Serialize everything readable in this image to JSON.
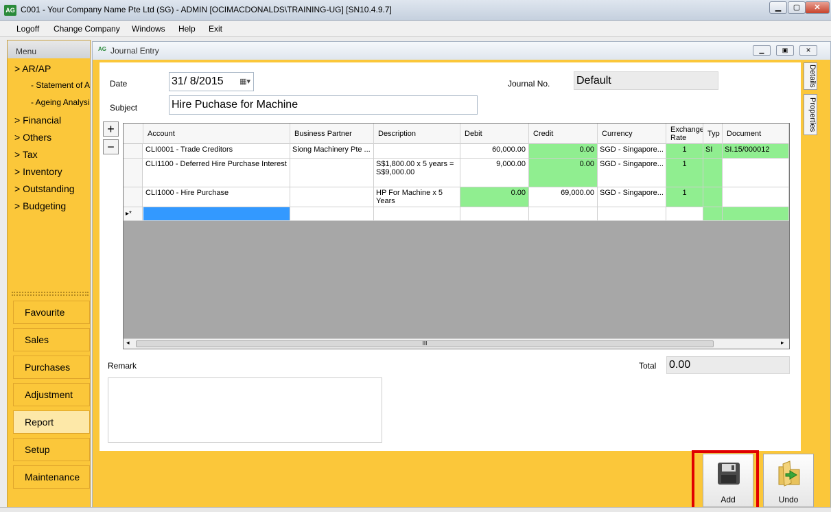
{
  "window": {
    "title": "C001 - Your Company Name Pte Ltd (SG) - ADMIN [OCIMACDONALDS\\TRAINING-UG] [SN10.4.9.7]",
    "logo": "AG",
    "minimize_icon": "minimize-icon",
    "maximize_icon": "maximize-icon",
    "close_icon": "close-icon"
  },
  "menubar": [
    "Logoff",
    "Change Company",
    "Windows",
    "Help",
    "Exit"
  ],
  "sidebar": {
    "header": "Menu",
    "links": [
      {
        "label": "> AR/AP"
      },
      {
        "label": "- Statement of A",
        "sub": true
      },
      {
        "label": "- Ageing Analysis",
        "sub": true
      },
      {
        "label": "> Financial"
      },
      {
        "label": "> Others"
      },
      {
        "label": "> Tax"
      },
      {
        "label": "> Inventory"
      },
      {
        "label": "> Outstanding"
      },
      {
        "label": "> Budgeting"
      }
    ],
    "buttons": [
      "Favourite",
      "Sales",
      "Purchases",
      "Adjustment",
      "Report",
      "Setup",
      "Maintenance"
    ],
    "active_button": "Report"
  },
  "journal": {
    "title": "Journal Entry",
    "logo": "AG",
    "date_label": "Date",
    "date_value": "31/  8/2015",
    "subject_label": "Subject",
    "subject_value": "Hire Puchase for Machine",
    "journal_no_label": "Journal No.",
    "journal_no_value": "Default",
    "add_row_symbol": "+",
    "remove_row_symbol": "−",
    "columns": [
      "Account",
      "Business Partner",
      "Description",
      "Debit",
      "Credit",
      "Currency",
      "Exchange Rate",
      "Typ",
      "Document"
    ],
    "rows": [
      {
        "account": "CLI0001 - Trade Creditors",
        "partner": "Siong Machinery Pte ...",
        "description": "",
        "debit": "60,000.00",
        "credit": "0.00",
        "currency": "SGD - Singapore...",
        "rate": "1",
        "type": "SI",
        "document": "SI.15/000012"
      },
      {
        "account": "CLI1100 - Deferred Hire Purchase Interest",
        "partner": "",
        "description": "S$1,800.00 x 5 years = S$9,000.00",
        "debit": "9,000.00",
        "credit": "0.00",
        "currency": "SGD - Singapore...",
        "rate": "1",
        "type": "",
        "document": ""
      },
      {
        "account": "CLI1000 - Hire Purchase",
        "partner": "",
        "description": "HP For Machine x 5 Years",
        "debit": "0.00",
        "credit": "69,000.00",
        "currency": "SGD - Singapore...",
        "rate": "1",
        "type": "",
        "document": ""
      }
    ],
    "new_row_marker": "▸*",
    "scroll_grip": "III",
    "remark_label": "Remark",
    "total_label": "Total",
    "total_value": "0.00",
    "side_tabs": [
      "Details",
      "Properties"
    ]
  },
  "actions": {
    "add_label": "Add",
    "undo_label": "Undo"
  }
}
